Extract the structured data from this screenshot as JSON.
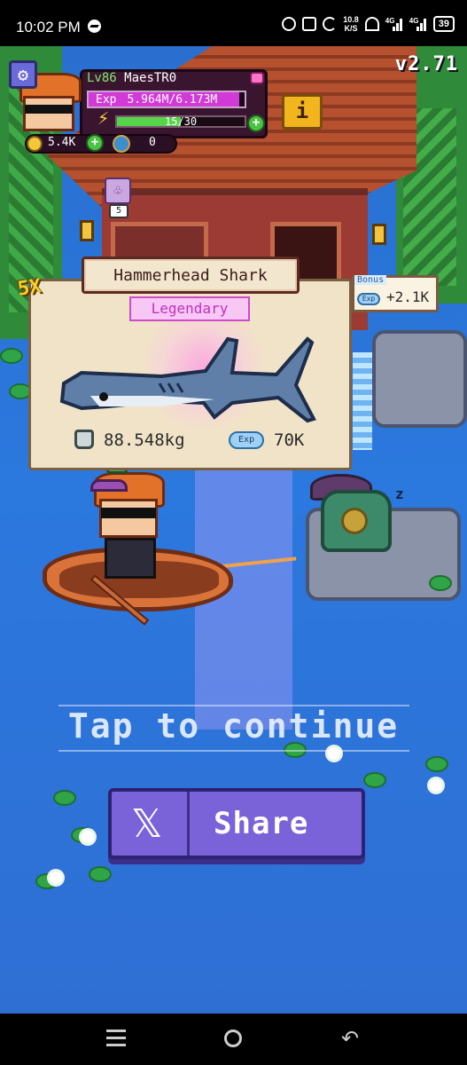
{
  "status_bar": {
    "time": "10:02 PM",
    "net_speed": "10.8",
    "net_unit": "K/S",
    "signal1": "4G",
    "signal2": "4G",
    "battery": "39"
  },
  "hud": {
    "version": "v2.71",
    "level": "Lv86",
    "player_name": "MaesTR0",
    "exp_label": "Exp",
    "exp_value": "5.964M/6.173M",
    "exp_progress": 0.966,
    "energy_value": "15/30",
    "energy_progress": 0.5,
    "coins": "5.4K",
    "gems": "0",
    "info_label": "i",
    "quest_count": "5"
  },
  "catch": {
    "multiplier": "5X",
    "fish_name": "Hammerhead Shark",
    "rarity": "Legendary",
    "weight": "88.548kg",
    "exp_badge": "Exp",
    "exp_reward": "70K",
    "bonus_label": "Bonus",
    "bonus_exp_badge": "Exp",
    "bonus_value": "+2.1K"
  },
  "actions": {
    "tap_to_continue": "Tap to continue",
    "share_label": "Share",
    "x_icon": "𝕏"
  },
  "colors": {
    "rarity": "#c22fc2",
    "share_button": "#7a62d8",
    "water": "#2b78de"
  }
}
